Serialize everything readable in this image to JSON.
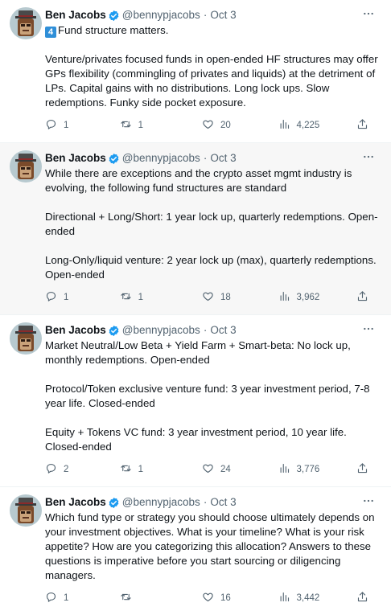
{
  "author": {
    "name": "Ben Jacobs",
    "handle": "@bennypjacobs",
    "separator": "·"
  },
  "icons": {
    "verified": "verified-badge-icon",
    "more": "more-dots-icon",
    "reply": "reply-icon",
    "retweet": "retweet-icon",
    "like": "heart-icon",
    "views": "views-bar-chart-icon",
    "share": "share-icon"
  },
  "colors": {
    "verified": "#1d9bf0",
    "secondary_text": "#536471",
    "highlight_bg": "#f7f7f7"
  },
  "tweets": [
    {
      "date": "Oct 3",
      "badge": "4",
      "paragraphs": [
        "Fund structure matters.",
        "",
        "Venture/privates focused funds in open-ended HF structures may offer GPs flexibility (commingling of privates and liquids) at the detriment of LPs. Capital gains with no distributions. Long lock ups. Slow redemptions. Funky side pocket exposure."
      ],
      "replies": "1",
      "retweets": "1",
      "likes": "20",
      "views": "4,225"
    },
    {
      "date": "Oct 3",
      "paragraphs": [
        "While there are exceptions and the crypto asset mgmt industry is evolving, the following fund structures are standard",
        "",
        "Directional + Long/Short: 1 year lock up, quarterly redemptions. Open-ended",
        "",
        "Long-Only/liquid venture: 2 year lock up (max), quarterly redemptions. Open-ended"
      ],
      "replies": "1",
      "retweets": "1",
      "likes": "18",
      "views": "3,962"
    },
    {
      "date": "Oct 3",
      "paragraphs": [
        "Market Neutral/Low Beta + Yield Farm + Smart-beta: No lock up, monthly redemptions. Open-ended",
        "",
        "Protocol/Token exclusive venture fund: 3 year investment period, 7-8 year life. Closed-ended",
        "",
        "Equity + Tokens VC fund: 3 year investment period, 10 year life. Closed-ended"
      ],
      "replies": "2",
      "retweets": "1",
      "likes": "24",
      "views": "3,776"
    },
    {
      "date": "Oct 3",
      "paragraphs": [
        "Which fund type or strategy you should choose ultimately depends on your investment objectives. What is your timeline? What is your risk appetite? How are you categorizing this allocation? Answers to these questions is imperative before you start sourcing or diligencing managers."
      ],
      "replies": "1",
      "retweets": "",
      "likes": "16",
      "views": "3,442"
    }
  ]
}
